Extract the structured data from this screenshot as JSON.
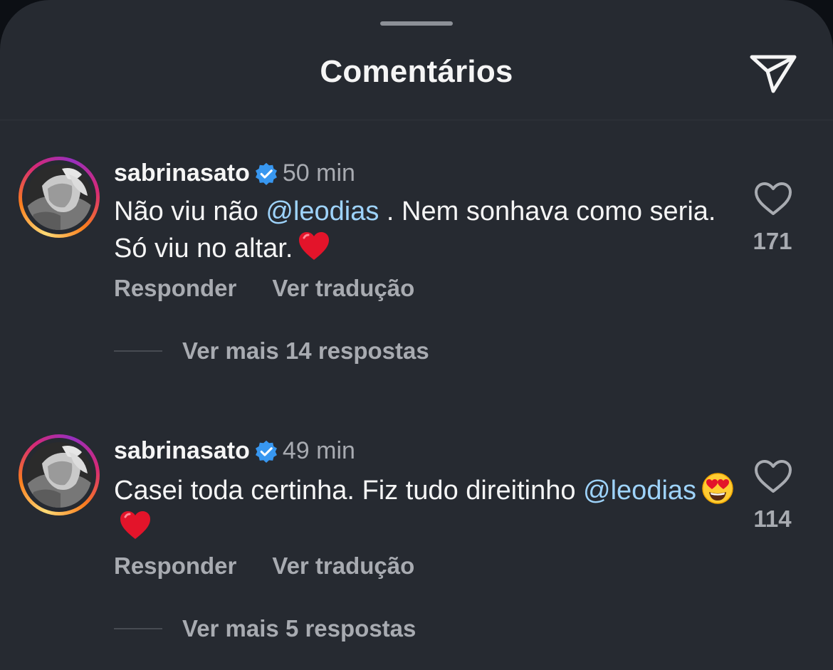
{
  "header": {
    "title": "Comentários",
    "share_icon": "paper-plane-icon"
  },
  "comments": [
    {
      "username": "sabrinasato",
      "verified": true,
      "time": "50 min",
      "text_part1": "Não viu não ",
      "mention1": "@leodias",
      "text_part2": " . Nem sonhava como seria. Só viu no altar.",
      "emojis": [
        "red-heart"
      ],
      "reply_label": "Responder",
      "translate_label": "Ver tradução",
      "likes": "171",
      "more_replies": "Ver mais 14 respostas"
    },
    {
      "username": "sabrinasato",
      "verified": true,
      "time": "49 min",
      "text_part1": "Casei toda certinha. Fiz tudo direitinho ",
      "mention1": "@leodias",
      "text_part2": "",
      "emojis": [
        "heart-eyes",
        "red-heart"
      ],
      "reply_label": "Responder",
      "translate_label": "Ver tradução",
      "likes": "114",
      "more_replies": "Ver mais 5 respostas"
    }
  ],
  "colors": {
    "background": "#262a31",
    "mention": "#9ed3fb",
    "secondary_text": "#a8abb1",
    "verified": "#3897f0"
  }
}
